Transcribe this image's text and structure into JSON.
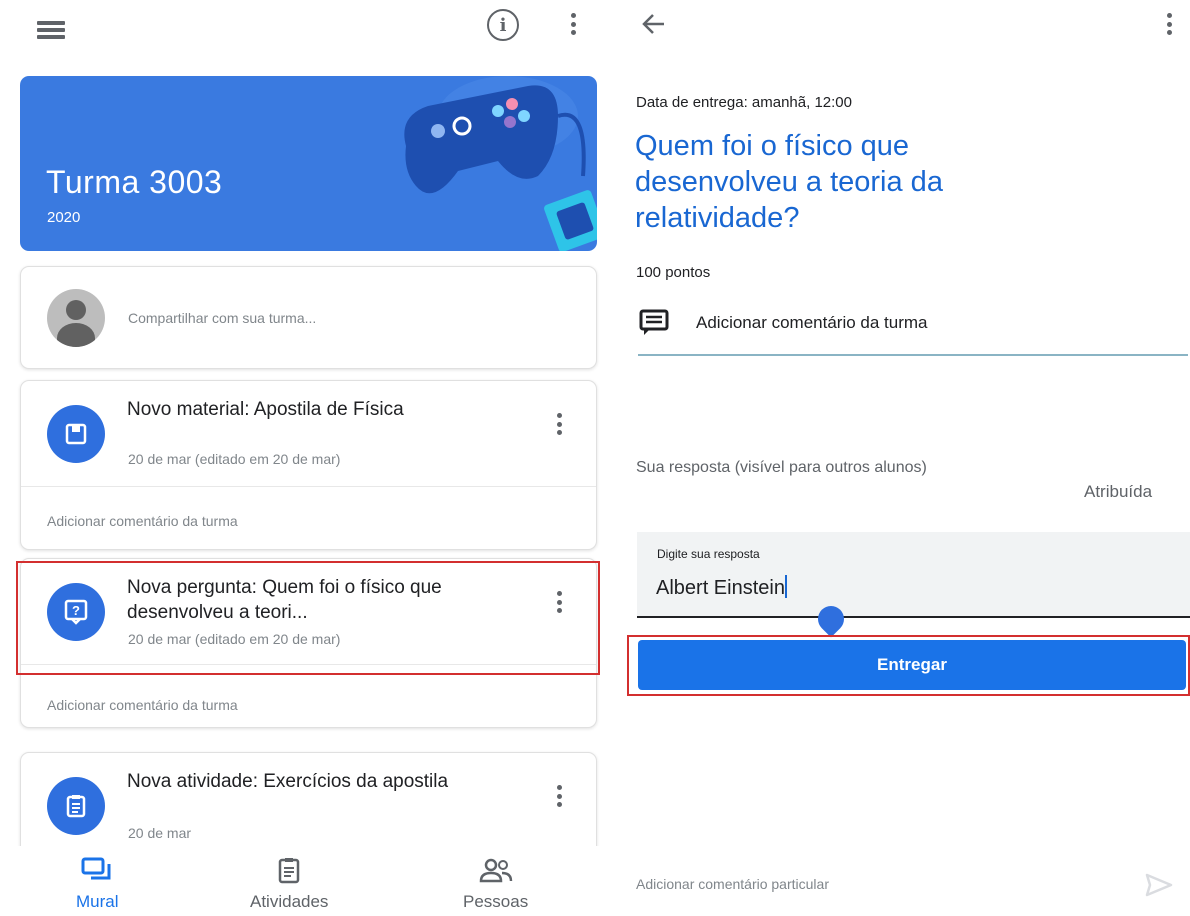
{
  "left": {
    "topbar": {
      "menu_icon": "hamburger-icon",
      "info_icon": "info-icon",
      "more_icon": "more-vert-icon"
    },
    "banner": {
      "title": "Turma 3003",
      "year": "2020",
      "color": "#3a7ae0"
    },
    "share": {
      "placeholder": "Compartilhar com sua turma..."
    },
    "posts": [
      {
        "title": "Novo material: Apostila de Física",
        "date": "20 de mar (editado em 20 de mar)",
        "icon": "material-icon",
        "comment": "Adicionar comentário da turma"
      },
      {
        "title": "Nova pergunta: Quem foi o físico que desenvolveu a teori...",
        "date": "20 de mar (editado em 20 de mar)",
        "icon": "question-icon",
        "comment": "Adicionar comentário da turma"
      },
      {
        "title": "Nova atividade: Exercícios da apostila",
        "date": "20 de mar",
        "icon": "assignment-icon"
      }
    ],
    "nav": [
      {
        "label": "Mural",
        "icon": "stream-icon",
        "active": true
      },
      {
        "label": "Atividades",
        "icon": "classwork-icon",
        "active": false
      },
      {
        "label": "Pessoas",
        "icon": "people-icon",
        "active": false
      }
    ]
  },
  "right": {
    "due": "Data de entrega: amanhã, 12:00",
    "question": "Quem foi o físico que desenvolveu a teoria da relatividade?",
    "points": "100 pontos",
    "class_comment": "Adicionar comentário da turma",
    "response_label": "Sua resposta (visível para outros alunos)",
    "status": "Atribuída",
    "answer": {
      "label": "Digite sua resposta",
      "value": "Albert Einstein"
    },
    "submit": "Entregar",
    "private_comment": "Adicionar comentário particular"
  },
  "colors": {
    "accent": "#1a73e8",
    "highlight": "#d32f2f"
  }
}
